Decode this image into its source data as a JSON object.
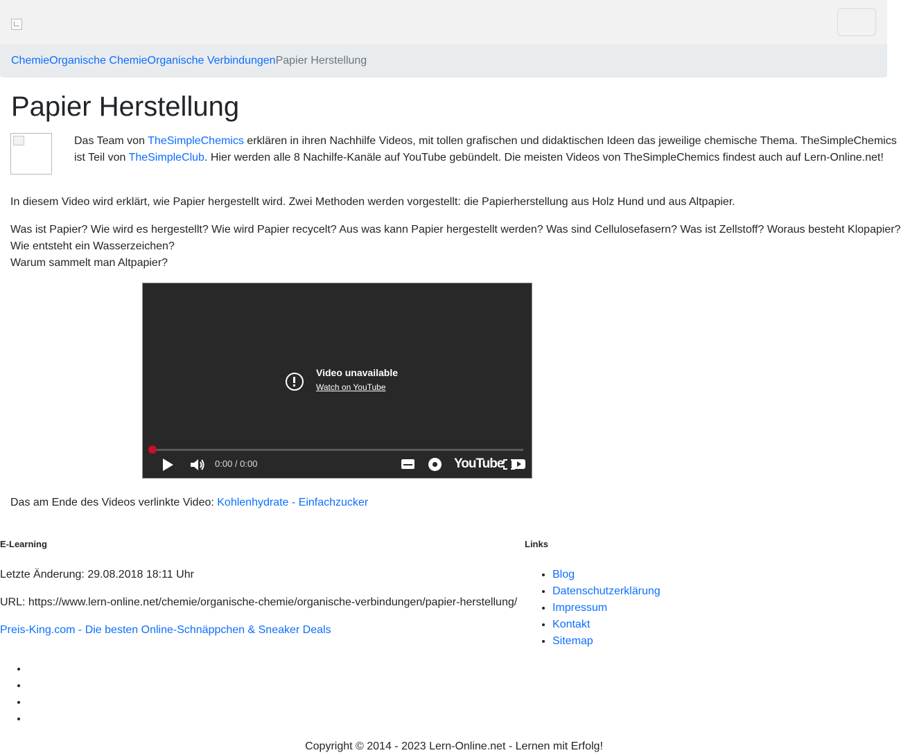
{
  "breadcrumb": {
    "items": [
      "Chemie",
      "Organische Chemie",
      "Organische Verbindungen"
    ],
    "current": "Papier Herstellung"
  },
  "page": {
    "title": "Papier Herstellung"
  },
  "intro": {
    "part1": "Das Team von ",
    "link1": "TheSimpleChemics",
    "part2": " erklären in ihren Nachhilfe Videos, mit tollen grafischen und didaktischen Ideen das jeweilige chemische Thema. TheSimpleChemics ist Teil von ",
    "link2": "TheSimpleClub",
    "part3": ". Hier werden alle 8 Nachilfe-Kanäle auf YouTube gebündelt. Die meisten Videos von TheSimpleChemics findest auch auf Lern-Online.net!"
  },
  "body": {
    "para1": "In diesem Video wird erklärt, wie Papier hergestellt wird. Zwei Methoden werden vorgestellt: die Papierherstellung aus Holz Hund und aus Altpapier.",
    "questions": [
      "Was ist Papier? Wie wird es hergestellt? Wie wird Papier recycelt? Aus was kann Papier hergestellt werden? Was sind Cellulosefasern? Was ist Zellstoff? Woraus besteht Klopapier?",
      "Wie entsteht ein Wasserzeichen?",
      "Warum sammelt man Altpapier?"
    ],
    "linked_prefix": "Das am Ende des Videos verlinkte Video: ",
    "linked_video": "Kohlenhydrate - Einfachzucker"
  },
  "video": {
    "status_title": "Video unavailable",
    "status_link": "Watch on YouTube",
    "time": "0:00 / 0:00",
    "logo": "YouTube",
    "progress": 0,
    "icons": [
      "alert-icon",
      "play-icon",
      "volume-icon",
      "captions-icon",
      "settings-icon",
      "fullscreen-icon"
    ]
  },
  "footer": {
    "elearning_heading": "E-Learning",
    "last_change": "Letzte Änderung: 29.08.2018 18:11 Uhr",
    "url": "URL: https://www.lern-online.net/chemie/organische-chemie/organische-verbindungen/papier-herstellung/",
    "partner_link": "Preis-King.com - Die besten Online-Schnäppchen & Sneaker Deals",
    "links_heading": "Links",
    "links": [
      "Blog",
      "Datenschutzerklärung",
      "Impressum",
      "Kontakt",
      "Sitemap"
    ],
    "copyright": "Copyright © 2014 - 2023 Lern-Online.net - Lernen mit Erfolg!"
  },
  "colors": {
    "link": "#0d6efd",
    "navbar_bg": "#f2f2f2",
    "breadcrumb_bg": "#e9ecef",
    "video_bg": "#282828",
    "video_scrub": "#c4102b"
  }
}
